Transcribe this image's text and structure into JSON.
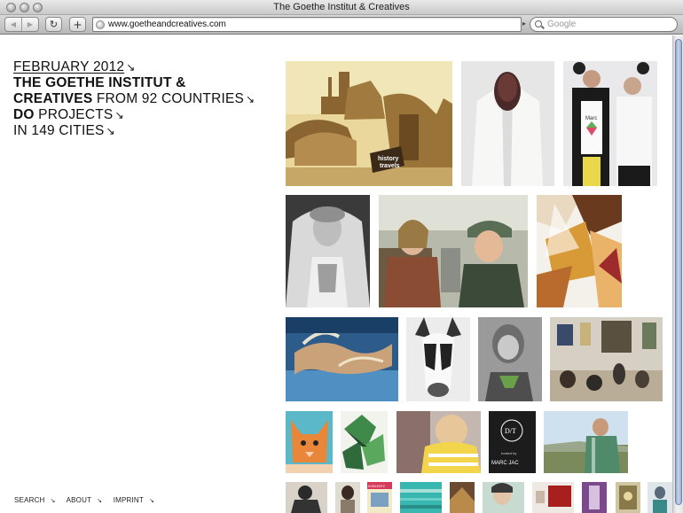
{
  "window": {
    "title": "The Goethe Institut & Creatives"
  },
  "toolbar": {
    "url": "www.goetheandcreatives.com",
    "search_placeholder": "Google",
    "back_icon": "back-arrow-icon",
    "forward_icon": "forward-arrow-icon",
    "reload_icon": "reload-icon",
    "add_icon": "add-bookmark-icon"
  },
  "page": {
    "headline": {
      "date": "FEBRUARY 2012",
      "line2": "THE GOETHE INSTITUT &",
      "creatives": "CREATIVES",
      "from": "FROM 92 COUNTRIES",
      "do": "DO",
      "projects": "PROJECTS",
      "cities": "IN 149 CITIES"
    },
    "footer": {
      "search": "SEARCH",
      "about": "ABOUT",
      "imprint": "IMPRINT"
    },
    "thumb_texts": {
      "history": "history",
      "travels": "travels",
      "marc": "Marc",
      "dt": "D/T",
      "hosted": "hosted by",
      "marcjac": "MARC JAC",
      "koblenz": "KOBLENTZ"
    },
    "accent_color": "#111111"
  }
}
